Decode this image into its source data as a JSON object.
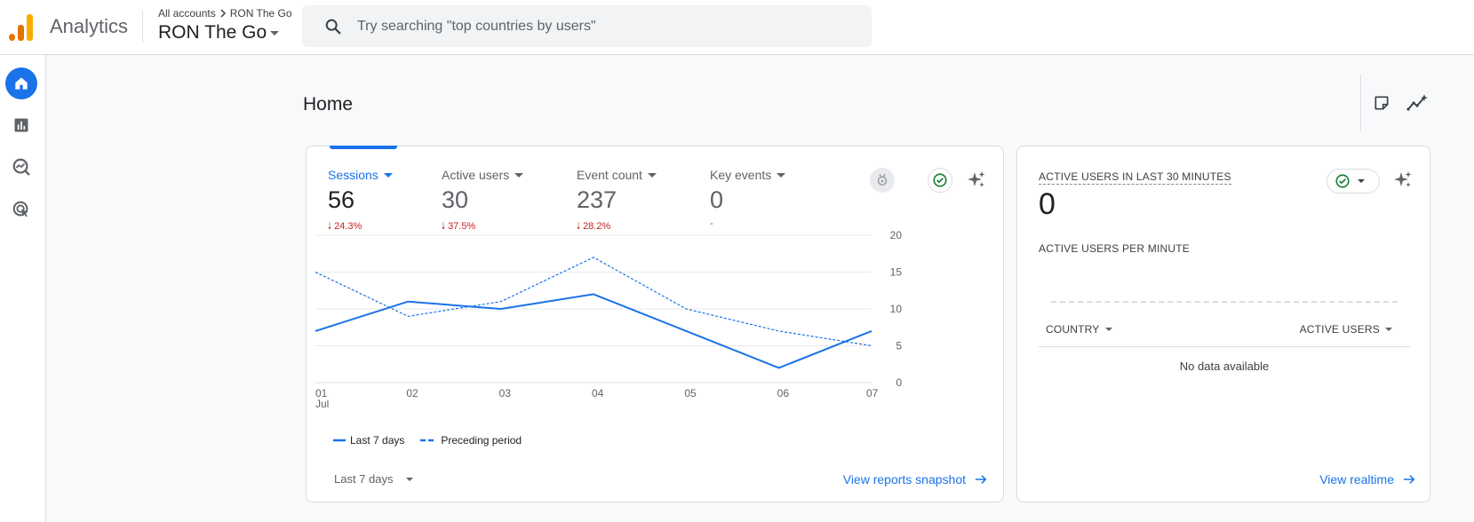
{
  "header": {
    "app_name": "Analytics",
    "breadcrumb_root": "All accounts",
    "breadcrumb_account": "RON The Go",
    "property_name": "RON The Go",
    "search_placeholder": "Try searching \"top countries by users\""
  },
  "page": {
    "title": "Home"
  },
  "metrics": [
    {
      "label": "Sessions",
      "value": "56",
      "delta": "24.3%",
      "direction": "down",
      "selected": true
    },
    {
      "label": "Active users",
      "value": "30",
      "delta": "37.5%",
      "direction": "down",
      "selected": false
    },
    {
      "label": "Event count",
      "value": "237",
      "delta": "28.2%",
      "direction": "down",
      "selected": false
    },
    {
      "label": "Key events",
      "value": "0",
      "delta": "-",
      "direction": "none",
      "selected": false
    }
  ],
  "chart_data": {
    "type": "line",
    "categories": [
      "01",
      "02",
      "03",
      "04",
      "05",
      "06",
      "07"
    ],
    "x_sublabel": "Jul",
    "ylim": [
      0,
      20
    ],
    "y_ticks": [
      "0",
      "5",
      "10",
      "15",
      "20"
    ],
    "y_axis_position": "right",
    "grid": true,
    "legend_position": "bottom-left",
    "series": [
      {
        "name": "Last 7 days",
        "values": [
          7,
          11,
          10,
          12,
          7,
          2,
          7
        ],
        "style": "solid",
        "color": "#1a73e8"
      },
      {
        "name": "Preceding period",
        "values": [
          15,
          9,
          11,
          17,
          10,
          7,
          5
        ],
        "style": "dashed",
        "color": "#1a73e8"
      }
    ]
  },
  "date_range": {
    "label": "Last 7 days"
  },
  "links": {
    "reports_snapshot": "View reports snapshot",
    "realtime": "View realtime"
  },
  "realtime": {
    "title": "ACTIVE USERS IN LAST 30 MINUTES",
    "value": "0",
    "per_minute_label": "ACTIVE USERS PER MINUTE",
    "col_country": "COUNTRY",
    "col_active_users": "ACTIVE USERS",
    "no_data": "No data available"
  },
  "colors": {
    "accent": "#1a73e8",
    "negative": "#c5221f",
    "success": "#188038",
    "logo_orange": "#f9ab00",
    "logo_dark_orange": "#e37400"
  },
  "icons": {
    "search": "search-icon",
    "home": "home-icon",
    "reports": "bar-chart-icon",
    "explore": "explore-icon",
    "advertising": "advertising-target-icon",
    "notes": "sticky-note-icon",
    "insights": "insights-sparkline-icon",
    "sparkle": "sparkle-icon",
    "check": "check-circle-icon",
    "arrow_forward": "arrow-forward-icon"
  }
}
